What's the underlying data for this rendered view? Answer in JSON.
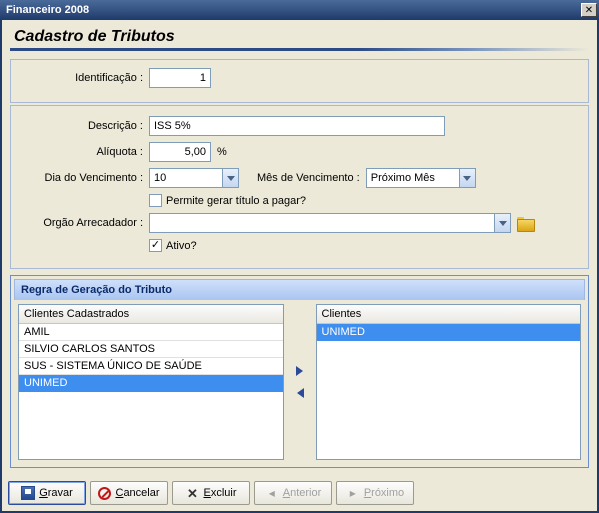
{
  "window": {
    "title": "Financeiro 2008"
  },
  "page": {
    "title": "Cadastro de Tributos"
  },
  "labels": {
    "identificacao": "Identificação :",
    "descricao": "Descrição :",
    "aliquota": "Alíquota :",
    "aliquota_suffix": "%",
    "dia_venc": "Dia do Vencimento :",
    "mes_venc": "Mês de Vencimento :",
    "permite_titulo": "Permite gerar título a pagar?",
    "orgao": "Orgão Arrecadador :",
    "ativo": "Ativo?"
  },
  "fields": {
    "identificacao": "1",
    "descricao": "ISS 5%",
    "aliquota": "5,00",
    "dia_venc": "10",
    "mes_venc": "Próximo Mês",
    "orgao": "",
    "permite_titulo_checked": false,
    "ativo_checked": true
  },
  "regra": {
    "title": "Regra de Geração do Tributo",
    "left_header": "Clientes Cadastrados",
    "right_header": "Clientes",
    "left_items": [
      {
        "label": "AMIL",
        "selected": false
      },
      {
        "label": "SILVIO CARLOS SANTOS",
        "selected": false
      },
      {
        "label": "SUS - SISTEMA ÚNICO DE SAÚDE",
        "selected": false
      },
      {
        "label": "UNIMED",
        "selected": true
      }
    ],
    "right_items": [
      {
        "label": "UNIMED",
        "selected": true
      }
    ]
  },
  "buttons": {
    "gravar": "Gravar",
    "cancelar": "Cancelar",
    "excluir": "Excluir",
    "anterior": "Anterior",
    "proximo": "Próximo"
  }
}
